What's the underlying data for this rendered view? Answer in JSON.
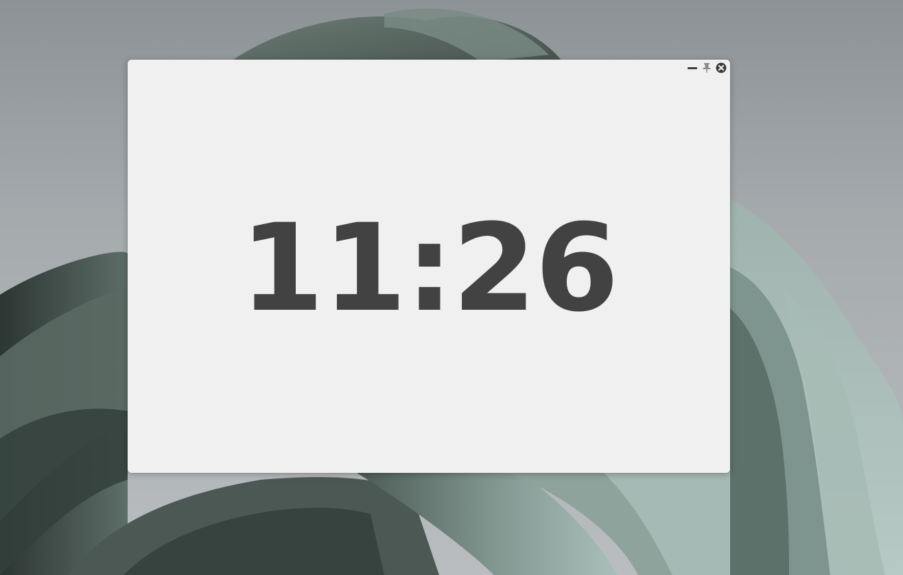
{
  "clock": {
    "time": "11:26"
  },
  "window_controls": {
    "minimize_icon": "minimize-icon",
    "pin_icon": "pin-icon",
    "close_icon": "close-icon"
  },
  "colors": {
    "window_background": "#f0f0f0",
    "clock_text": "#424242",
    "wallpaper_accent": "#8ea39c"
  }
}
